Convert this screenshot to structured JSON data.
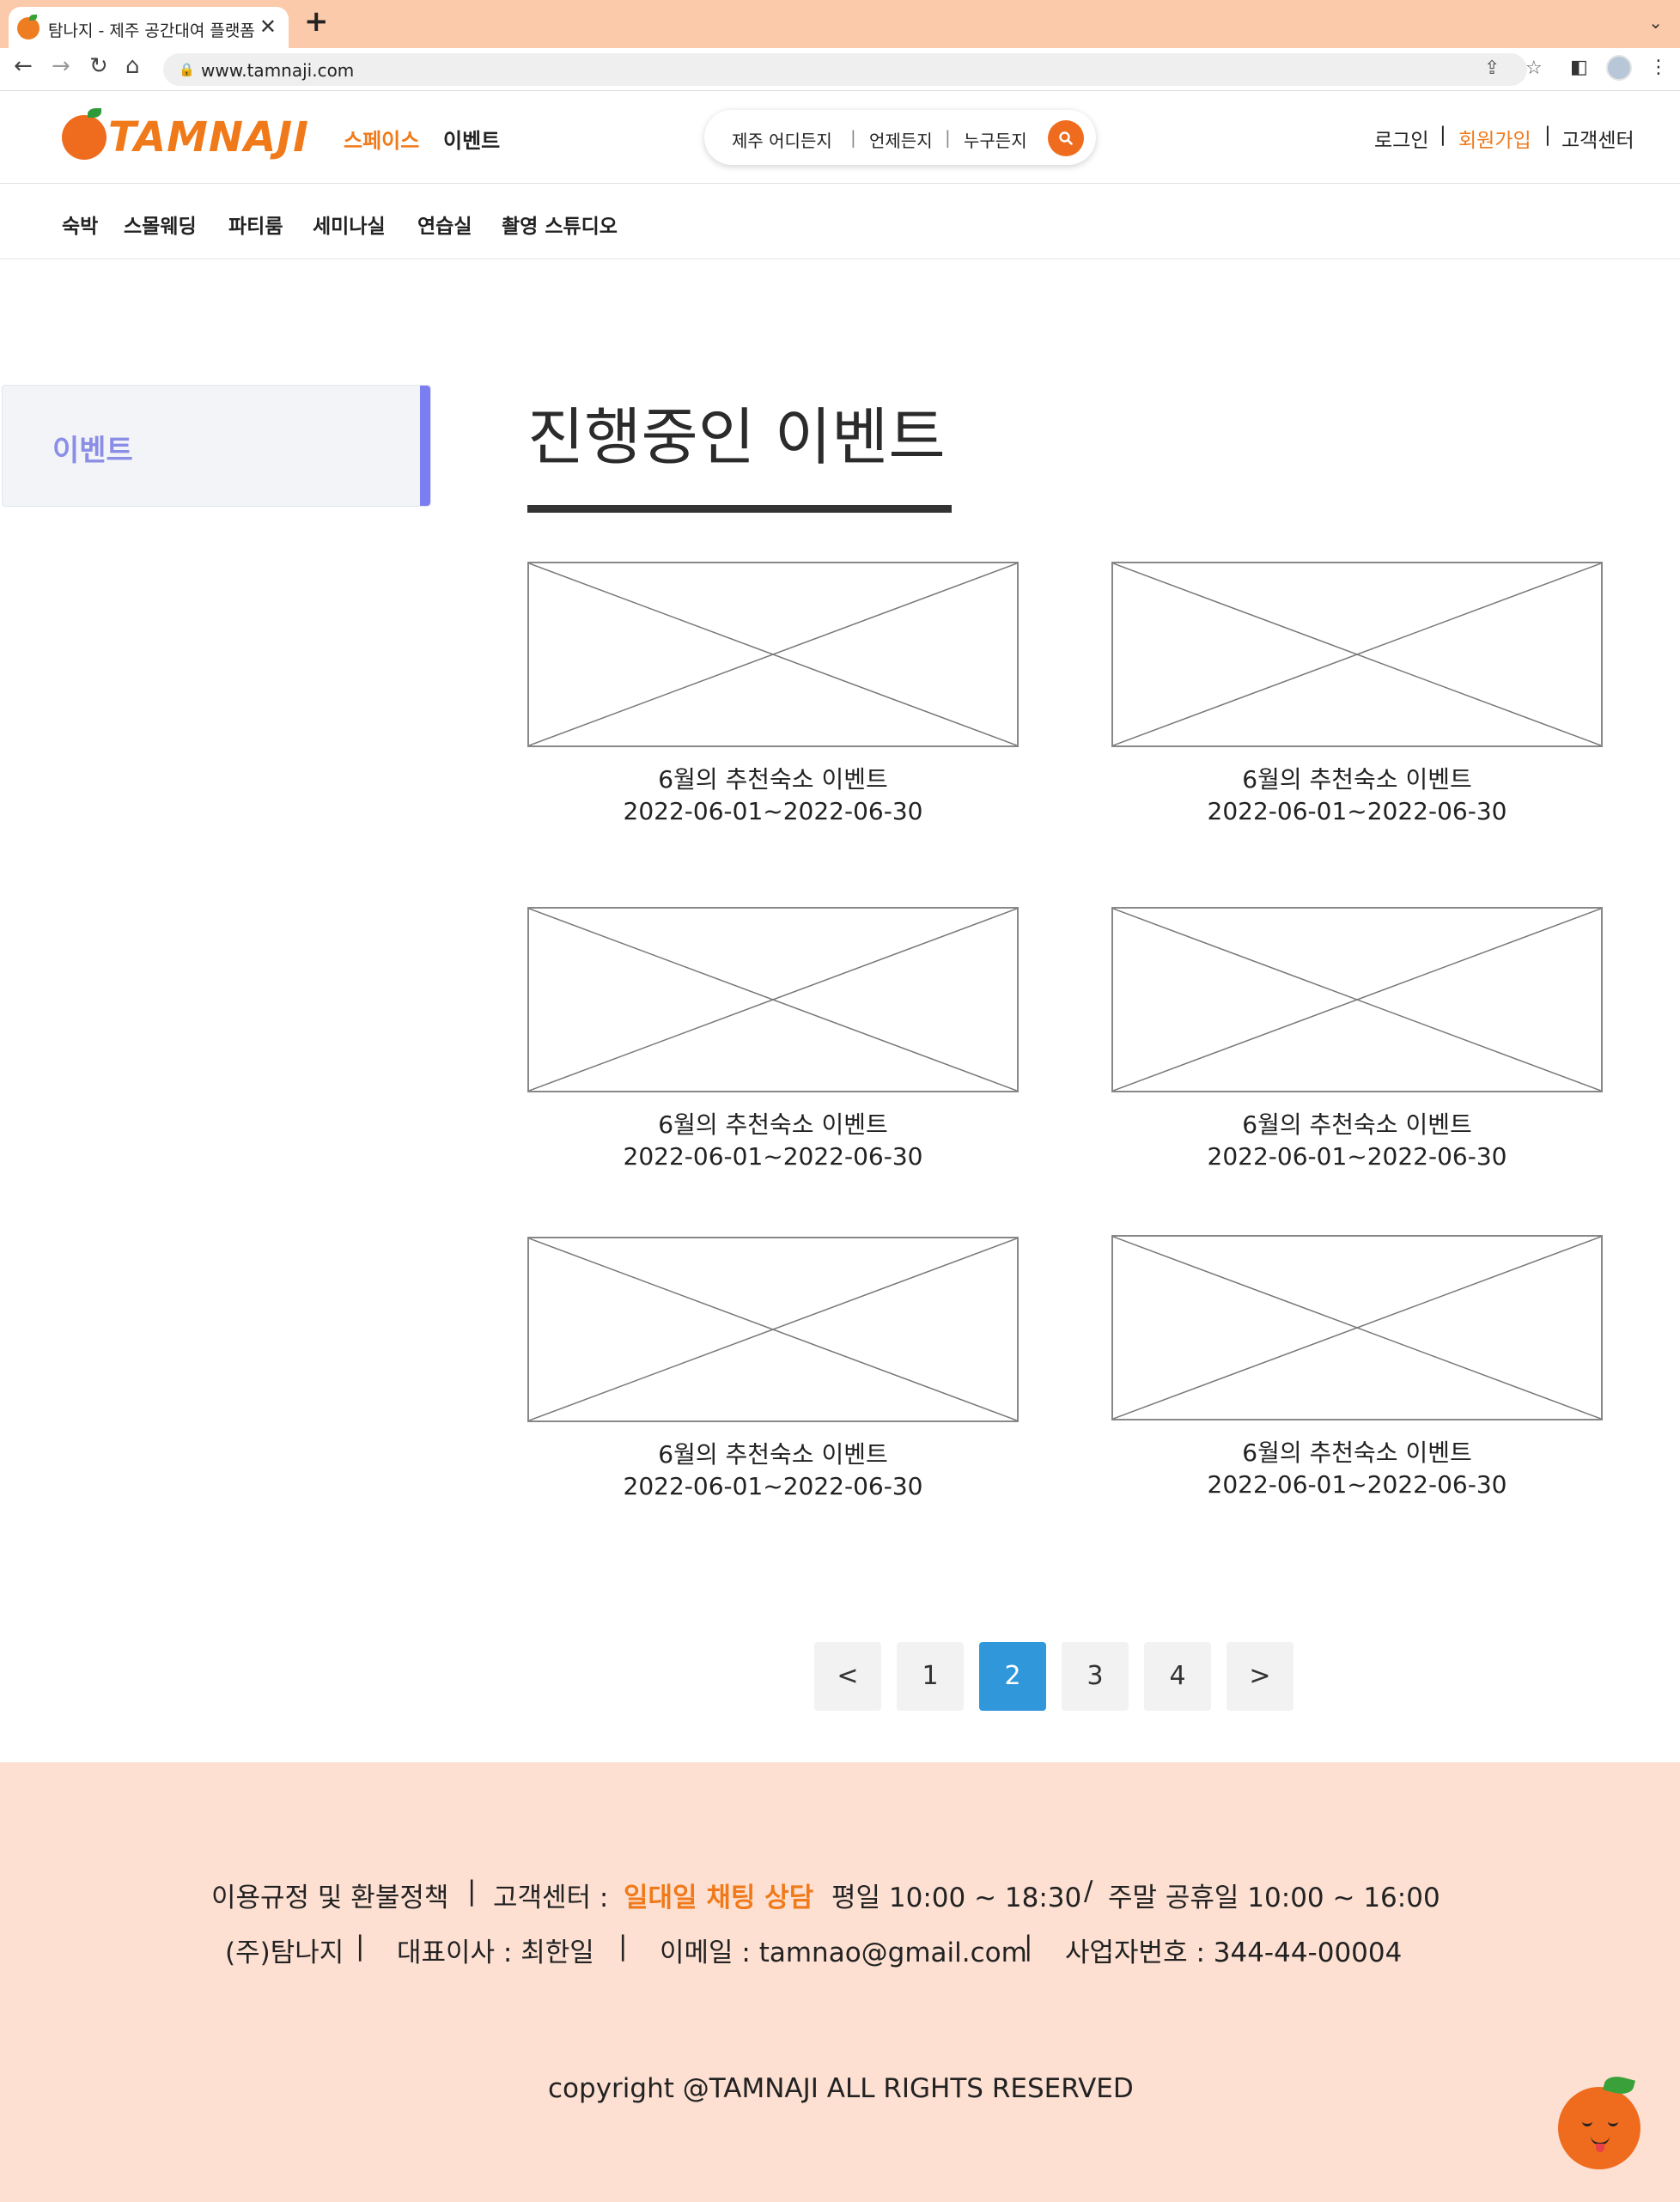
{
  "browser": {
    "tab_title": "탐나지 - 제주 공간대여 플랫폼",
    "tab_close": "✕",
    "new_tab": "+",
    "tab_list": "⌄",
    "url": "www.tamnaji.com",
    "icons": {
      "back": "←",
      "forward": "→",
      "reload": "↻",
      "home": "⌂",
      "share": "⇪",
      "bookmark": "☆",
      "sidepanel": "◧",
      "menu": "⋮",
      "lock": "🔒"
    }
  },
  "header": {
    "logo_text": "TAMNAJI",
    "nav": {
      "space": "스페이스",
      "event": "이벤트"
    },
    "search": {
      "where": "제주 어디든지",
      "when": "언제든지",
      "who": "누구든지",
      "divider": "|"
    },
    "util": {
      "login": "로그인",
      "signup": "회원가입",
      "support": "고객센터",
      "divider": "|"
    }
  },
  "categories": [
    "숙박",
    "스몰웨딩",
    "파티룸",
    "세미나실",
    "연습실",
    "촬영 스튜디오"
  ],
  "sidebar": {
    "item": "이벤트"
  },
  "main": {
    "title": "진행중인 이벤트"
  },
  "events": [
    {
      "title": "6월의 추천숙소 이벤트",
      "date": "2022-06-01~2022-06-30"
    },
    {
      "title": "6월의 추천숙소 이벤트",
      "date": "2022-06-01~2022-06-30"
    },
    {
      "title": "6월의 추천숙소 이벤트",
      "date": "2022-06-01~2022-06-30"
    },
    {
      "title": "6월의 추천숙소 이벤트",
      "date": "2022-06-01~2022-06-30"
    },
    {
      "title": "6월의 추천숙소 이벤트",
      "date": "2022-06-01~2022-06-30"
    },
    {
      "title": "6월의 추천숙소 이벤트",
      "date": "2022-06-01~2022-06-30"
    }
  ],
  "pagination": {
    "prev": "<",
    "pages": [
      "1",
      "2",
      "3",
      "4"
    ],
    "current": "2",
    "next": ">"
  },
  "footer": {
    "policy": "이용규정 및 환불정책",
    "sep": "|",
    "support_label": "고객센터 :",
    "chat": "일대일 채팅 상담",
    "weekday": "평일 10:00 ~ 18:30",
    "slash": "/",
    "weekend": "주말 공휴일 10:00 ~ 16:00",
    "company": "(주)탐나지",
    "ceo": "대표이사 : 최한일",
    "email": "이메일 : tamnao@gmail.com",
    "bizno": "사업자번호 : 344-44-00004",
    "copyright": "copyright @TAMNAJI ALL RIGHTS RESERVED"
  },
  "colors": {
    "accent": "#f07a1a",
    "active_page": "#2f97da",
    "sidebar_accent": "#7b7ef0",
    "footer_bg": "#fde0d2",
    "tabstrip": "#fbcaaa"
  }
}
